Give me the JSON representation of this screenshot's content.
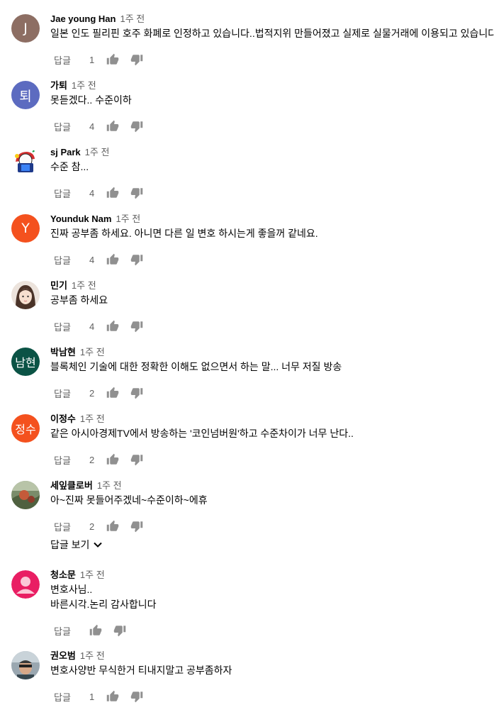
{
  "comments": [
    {
      "author": "Jae young Han",
      "time": "1주 전",
      "lines": [
        "일본 인도 필리핀 호주 화폐로 인정하고 있습니다..법적지위 만들어졌고 실제로 실물거래에 이용되고 있습니다."
      ],
      "reply_label": "답글",
      "likes": "1",
      "avatar_initial": "J",
      "avatar_color": "#8d6e63"
    },
    {
      "author": "가퇴",
      "time": "1주 전",
      "lines": [
        "못듣겠다.. 수준이하"
      ],
      "reply_label": "답글",
      "likes": "4",
      "avatar_initial": "퇴",
      "avatar_color": "#5c6bc0"
    },
    {
      "author": "sj Park",
      "time": "1주 전",
      "lines": [
        "수준 참..."
      ],
      "reply_label": "답글",
      "likes": "4",
      "avatar_initial": "",
      "avatar_color": "#ffffff"
    },
    {
      "author": "Younduk Nam",
      "time": "1주 전",
      "lines": [
        "진짜 공부좀 하세요. 아니면 다른 일 변호 하시는게 좋을꺼 같네요."
      ],
      "reply_label": "답글",
      "likes": "4",
      "avatar_initial": "Y",
      "avatar_color": "#f4511e"
    },
    {
      "author": "민기",
      "time": "1주 전",
      "lines": [
        "공부좀 하세요"
      ],
      "reply_label": "답글",
      "likes": "4",
      "avatar_initial": "",
      "avatar_color": "#e8ddd5"
    },
    {
      "author": "박남현",
      "time": "1주 전",
      "lines": [
        "블록체인 기술에 대한 정확한 이해도 없으면서 하는 말... 너무 저질 방송"
      ],
      "reply_label": "답글",
      "likes": "2",
      "avatar_initial": "남현",
      "avatar_color": "#0b5345"
    },
    {
      "author": "이정수",
      "time": "1주 전",
      "lines": [
        "같은 아시아경제TV에서 방송하는 '코인넘버원'하고 수준차이가 너무 난다.."
      ],
      "reply_label": "답글",
      "likes": "2",
      "avatar_initial": "정수",
      "avatar_color": "#f4511e"
    },
    {
      "author": "세잎클로버",
      "time": "1주 전",
      "lines": [
        "아~진짜 못들어주겠네~수준이하~에휴"
      ],
      "reply_label": "답글",
      "likes": "2",
      "avatar_initial": "",
      "avatar_color": "#6b7f5a"
    },
    {
      "author": "청소문",
      "time": "1주 전",
      "lines": [
        "변호사님..",
        "바른시각.논리  감사합니다"
      ],
      "reply_label": "답글",
      "likes": "",
      "avatar_initial": "",
      "avatar_color": "#e91e63"
    },
    {
      "author": "권오범",
      "time": "1주 전",
      "lines": [
        "변호사양반 무식한거 티내지말고 공부좀하자"
      ],
      "reply_label": "답글",
      "likes": "1",
      "avatar_initial": "",
      "avatar_color": "#7b8b95"
    }
  ],
  "view_replies_label": "답글 보기",
  "icons": {
    "like": "thumb-up-icon",
    "dislike": "thumb-down-icon",
    "expand": "chevron-down-icon"
  },
  "colors": {
    "text": "#030303",
    "secondary": "#606060",
    "icon": "#909090"
  }
}
